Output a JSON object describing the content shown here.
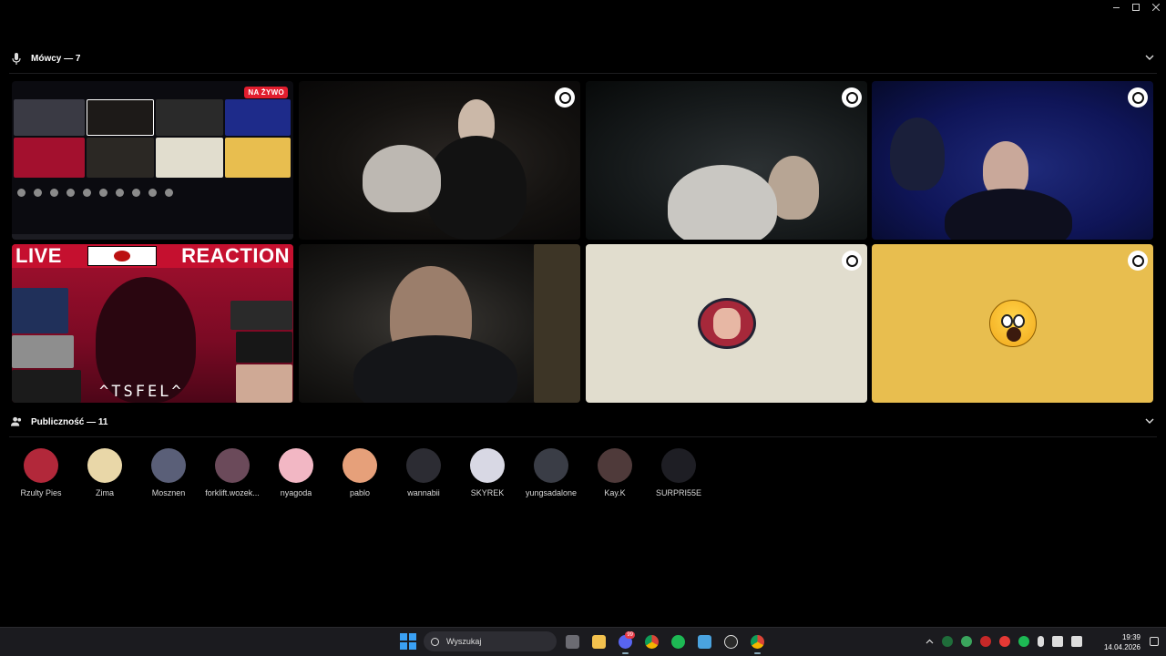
{
  "speakers": {
    "title": "Mówcy — 7",
    "live_label": "NA ŻYWO",
    "reaction_left": "LIVE",
    "reaction_right": "REACTION",
    "reaction_name": "^TSFEL^"
  },
  "audience": {
    "title": "Publiczność — 11",
    "members": [
      {
        "name": "Rzulty Pies",
        "color": "#b2283a"
      },
      {
        "name": "Zima",
        "color": "#e9d7a8"
      },
      {
        "name": "Mosznen",
        "color": "#5a5f78"
      },
      {
        "name": "forklift.wozek...",
        "color": "#6b4a5a"
      },
      {
        "name": "nyagoda",
        "color": "#f2b7c4"
      },
      {
        "name": "pablo",
        "color": "#e6a07a"
      },
      {
        "name": "wannabii",
        "color": "#2c2c33"
      },
      {
        "name": "SKYREK",
        "color": "#d8d8e4"
      },
      {
        "name": "yungsadalone",
        "color": "#3a3d46"
      },
      {
        "name": "Kay.K",
        "color": "#4f3a3a"
      },
      {
        "name": "SURPRI55E",
        "color": "#1e1e24"
      }
    ]
  },
  "taskbar": {
    "search_placeholder": "Wyszukaj",
    "discord_badge": "99",
    "time": "19:39",
    "date": "14.04.2026",
    "apps": [
      "task-view",
      "file-explorer",
      "discord",
      "chrome",
      "spotify",
      "notepad",
      "obs",
      "chrome-active"
    ]
  },
  "colors": {
    "background": "#000000",
    "live_red": "#e11d2e",
    "yellow_tile": "#e8be4f",
    "beige_tile": "#e1ddce",
    "start_blue": "#3aa0f3"
  }
}
